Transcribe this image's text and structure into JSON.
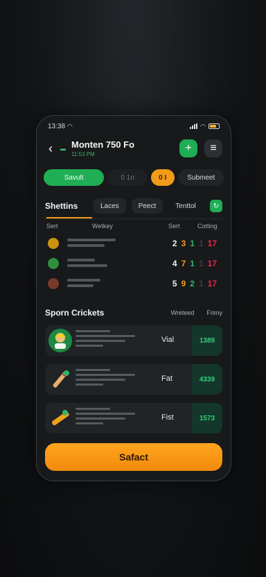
{
  "status": {
    "time": "13:38",
    "wifi_icon": "wifi-icon",
    "signal_icon": "signal-icon",
    "battery_icon": "battery-icon"
  },
  "header": {
    "title": "Monten 750 Fo",
    "subtitle": "11:53 PM",
    "back_icon": "chevron-left-icon",
    "add_icon": "plus-icon",
    "menu_icon": "menu-icon"
  },
  "pills": {
    "active": "Savult",
    "ghost": "0 1n",
    "badge": "0 I",
    "outline": "Submeet"
  },
  "tabs": {
    "main": "Shettins",
    "t1": "Laces",
    "t2": "Peect",
    "t3": "Tenttol"
  },
  "columns": {
    "c1": "Sert",
    "c2": "Wetkey",
    "c3": "Sert",
    "c4": "Cotting"
  },
  "rows": [
    {
      "n1": "2",
      "n2": "3",
      "n3": "1",
      "n4": "1",
      "n5": "17",
      "icon_color": "#c9930d"
    },
    {
      "n1": "4",
      "n2": "7",
      "n3": "1",
      "n4": "1",
      "n5": "17",
      "icon_color": "#2f8f3e"
    },
    {
      "n1": "5",
      "n2": "9",
      "n3": "2",
      "n4": "1",
      "n5": "17",
      "icon_color": "#7a3a2a"
    }
  ],
  "section": {
    "title": "Sporn Crickets",
    "col1": "Wreteed",
    "col2": "Frimy"
  },
  "cards": [
    {
      "label": "Vial",
      "value": "1389",
      "art": "cricket-player-icon"
    },
    {
      "label": "Fat",
      "value": "4339",
      "art": "cricket-bat-icon"
    },
    {
      "label": "Fist",
      "value": "1573",
      "art": "cricket-bat-ball-icon"
    }
  ],
  "cta": {
    "label": "Safact"
  },
  "colors": {
    "accent_green": "#1fae55",
    "accent_orange": "#f29a1a",
    "accent_red": "#e2284e"
  }
}
